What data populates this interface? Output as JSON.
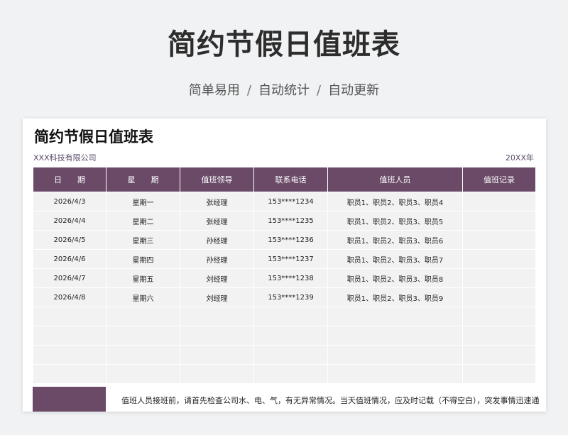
{
  "hero": {
    "title": "简约节假日值班表",
    "tags": [
      "简单易用",
      "自动统计",
      "自动更新"
    ],
    "separator": "/"
  },
  "sheet": {
    "title": "简约节假日值班表",
    "company": "XXX科技有限公司",
    "year": "20XX年",
    "columns": [
      "日　　期",
      "星　　期",
      "值班领导",
      "联系电话",
      "值班人员",
      "值班记录"
    ],
    "rows": [
      [
        "2026/4/3",
        "星期一",
        "张经理",
        "153****1234",
        "职员1、职员2、职员3、职员4",
        ""
      ],
      [
        "2026/4/4",
        "星期二",
        "张经理",
        "153****1235",
        "职员1、职员2、职员3、职员5",
        ""
      ],
      [
        "2026/4/5",
        "星期三",
        "孙经理",
        "153****1236",
        "职员1、职员2、职员3、职员6",
        ""
      ],
      [
        "2026/4/6",
        "星期四",
        "孙经理",
        "153****1237",
        "职员1、职员2、职员3、职员7",
        ""
      ],
      [
        "2026/4/7",
        "星期五",
        "刘经理",
        "153****1238",
        "职员1、职员2、职员3、职员8",
        ""
      ],
      [
        "2026/4/8",
        "星期六",
        "刘经理",
        "153****1239",
        "职员1、职员2、职员3、职员9",
        ""
      ],
      [
        "",
        "",
        "",
        "",
        "",
        ""
      ],
      [
        "",
        "",
        "",
        "",
        "",
        ""
      ],
      [
        "",
        "",
        "",
        "",
        "",
        ""
      ],
      [
        "",
        "",
        "",
        "",
        "",
        ""
      ]
    ],
    "footnote": "值班人员接班前，请首先检查公司水、电、气，有无异常情况。当天值班情况，应及时记载（不得空白），突发事情迅速通"
  },
  "colors": {
    "header_bg": "#6a4a67",
    "cell_bg": "#f2f2f3",
    "page_bg": "#f1f2f4"
  }
}
